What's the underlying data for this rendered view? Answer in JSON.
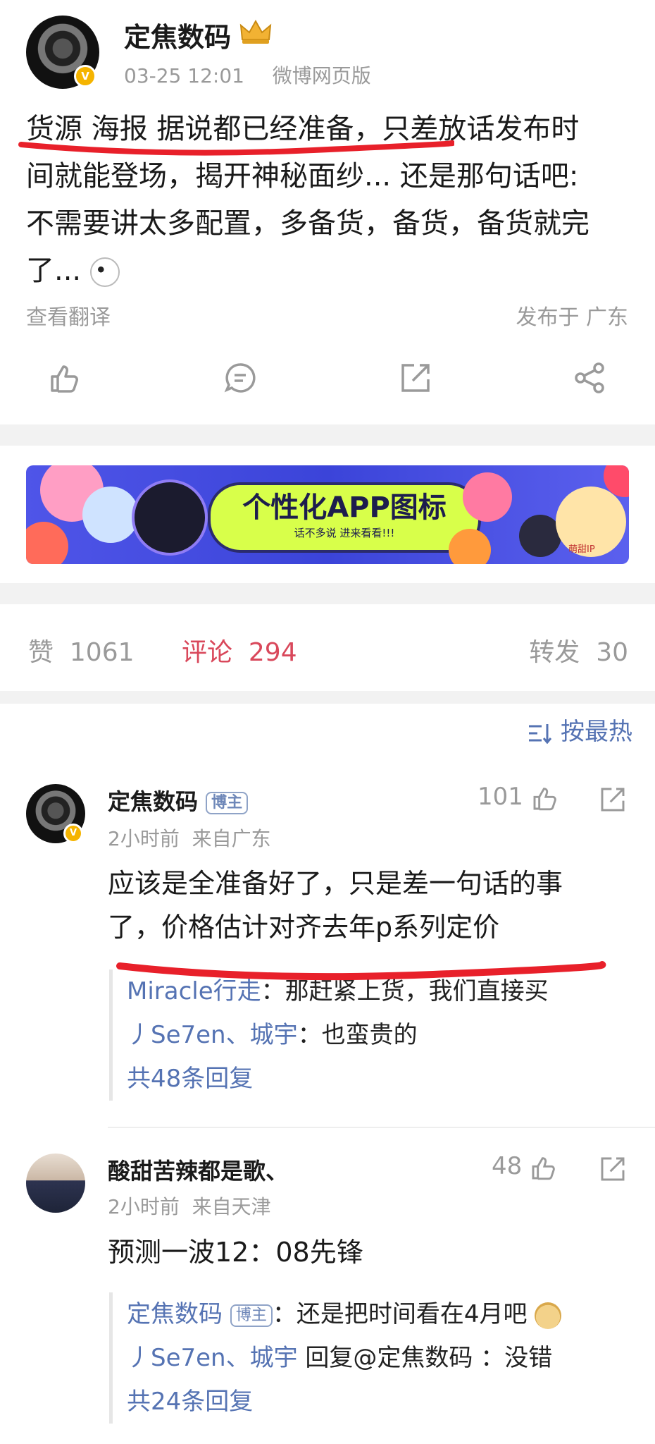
{
  "post": {
    "author": "定焦数码",
    "timestamp": "03-25 12:01",
    "source": "微博网页版",
    "content_lines": [
      "货源 海报 据说都已经准备，只差放话发布时",
      "间就能登场，揭开神秘面纱... 还是那句话吧:",
      "不需要讲太多配置，多备货，备货，备货就完",
      "了..."
    ],
    "translate_label": "查看翻译",
    "published_in": "发布于 广东"
  },
  "actions": {
    "like_icon": "thumbs-up-icon",
    "comment_icon": "comment-icon",
    "repost_icon": "share-box-icon",
    "share_icon": "share-network-icon"
  },
  "banner": {
    "title": "个性化APP图标",
    "subtitle": "话不多说 进来看看!!!",
    "logo_text": "萌甜IP"
  },
  "stats": {
    "likes_label": "赞",
    "likes_count": "1061",
    "comments_label": "评论",
    "comments_count": "294",
    "reposts_label": "转发",
    "reposts_count": "30"
  },
  "sort": {
    "label": "按最热",
    "icon": "sort-icon"
  },
  "comments": [
    {
      "author": "定焦数码",
      "badge": "博主",
      "likes": "101",
      "time": "2小时前",
      "location": "来自广东",
      "text_lines": [
        "应该是全准备好了，只是差一句话的事",
        "了，价格估计对齐去年p系列定价"
      ],
      "replies": [
        {
          "name": "Miracle行走",
          "badge": "",
          "text": "：那赶紧上货，我们直接买"
        },
        {
          "name": "丿Se7en、城宇",
          "badge": "",
          "text": "：也蛮贵的"
        }
      ],
      "more_replies": "共48条回复"
    },
    {
      "author": "酸甜苦辣都是歌、",
      "badge": "",
      "likes": "48",
      "time": "2小时前",
      "location": "来自天津",
      "text_lines": [
        "预测一波12：08先锋"
      ],
      "replies": [
        {
          "name": "定焦数码",
          "badge": "博主",
          "text": "：还是把时间看在4月吧"
        },
        {
          "name": "丿Se7en、城宇",
          "badge": "",
          "text": " 回复@定焦数码 ：没错"
        }
      ],
      "more_replies": "共24条回复"
    }
  ],
  "colors": {
    "annotation_red": "#e8202a",
    "link_blue": "#5573b3",
    "comment_active": "#d9485b"
  }
}
